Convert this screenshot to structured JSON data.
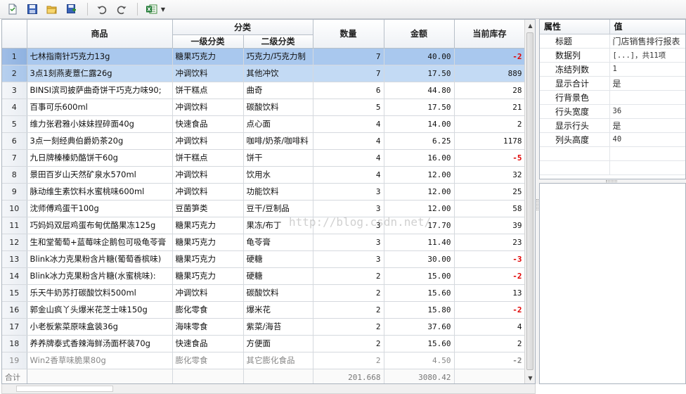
{
  "toolbar": {
    "buttons": [
      "new-icon",
      "save-icon",
      "open-folder-icon",
      "save-as-icon",
      "undo-icon",
      "redo-icon",
      "excel-export-icon"
    ]
  },
  "grid": {
    "headers": {
      "product": "商品",
      "category": "分类",
      "level1": "一级分类",
      "level2": "二级分类",
      "qty": "数量",
      "amount": "金额",
      "stock": "当前库存"
    },
    "rows": [
      {
        "n": "1",
        "name": "七林指南针巧克力13g",
        "c1": "糖果巧克力",
        "c2": "巧克力/巧克力制",
        "qty": "7",
        "amt": "40.00",
        "stock": "-2"
      },
      {
        "n": "2",
        "name": "3点1刻燕麦薏仁露26g",
        "c1": "冲调饮料",
        "c2": "其他冲饮",
        "qty": "7",
        "amt": "17.50",
        "stock": "889"
      },
      {
        "n": "3",
        "name": "BINSI滨司披萨曲奇饼干巧克力味90;",
        "c1": "饼干糕点",
        "c2": "曲奇",
        "qty": "6",
        "amt": "44.80",
        "stock": "28"
      },
      {
        "n": "4",
        "name": "百事可乐600ml",
        "c1": "冲调饮料",
        "c2": "碳酸饮料",
        "qty": "5",
        "amt": "17.50",
        "stock": "21"
      },
      {
        "n": "5",
        "name": "维力张君雅小妹妹捏碎面40g",
        "c1": "快速食品",
        "c2": "点心面",
        "qty": "4",
        "amt": "14.00",
        "stock": "2"
      },
      {
        "n": "6",
        "name": "3点一刻经典伯爵奶茶20g",
        "c1": "冲调饮料",
        "c2": "咖啡/奶茶/咖啡料",
        "qty": "4",
        "amt": "6.25",
        "stock": "1178"
      },
      {
        "n": "7",
        "name": "九日牌榛榛奶酪饼干60g",
        "c1": "饼干糕点",
        "c2": "饼干",
        "qty": "4",
        "amt": "16.00",
        "stock": "-5"
      },
      {
        "n": "8",
        "name": "景田百岁山天然矿泉水570ml",
        "c1": "冲调饮料",
        "c2": "饮用水",
        "qty": "4",
        "amt": "12.00",
        "stock": "32"
      },
      {
        "n": "9",
        "name": "脉动维生素饮料水蜜桃味600ml",
        "c1": "冲调饮料",
        "c2": "功能饮料",
        "qty": "3",
        "amt": "12.00",
        "stock": "25"
      },
      {
        "n": "10",
        "name": "沈师傅鸡蛋干100g",
        "c1": "豆菌笋类",
        "c2": "豆干/豆制品",
        "qty": "3",
        "amt": "12.00",
        "stock": "58"
      },
      {
        "n": "11",
        "name": "巧妈妈双层鸡蛋布甸优酪果冻125g",
        "c1": "糖果巧克力",
        "c2": "果冻/布丁",
        "qty": "3",
        "amt": "17.70",
        "stock": "39"
      },
      {
        "n": "12",
        "name": "生和堂葡萄+蓝莓味企鹅包可吸龟苓膏",
        "c1": "糖果巧克力",
        "c2": "龟苓膏",
        "qty": "3",
        "amt": "11.40",
        "stock": "23"
      },
      {
        "n": "13",
        "name": "Blink冰力克果粉含片糖(葡萄香槟味)",
        "c1": "糖果巧克力",
        "c2": "硬糖",
        "qty": "3",
        "amt": "30.00",
        "stock": "-3"
      },
      {
        "n": "14",
        "name": "Blink冰力克果粉含片糖(水蜜桃味):",
        "c1": "糖果巧克力",
        "c2": "硬糖",
        "qty": "2",
        "amt": "15.00",
        "stock": "-2"
      },
      {
        "n": "15",
        "name": "乐天牛奶苏打碳酸饮料500ml",
        "c1": "冲调饮料",
        "c2": "碳酸饮料",
        "qty": "2",
        "amt": "15.60",
        "stock": "13"
      },
      {
        "n": "16",
        "name": "郭金山疯丫头爆米花芝士味150g",
        "c1": "膨化零食",
        "c2": "爆米花",
        "qty": "2",
        "amt": "15.80",
        "stock": "-2"
      },
      {
        "n": "17",
        "name": "小老板紫菜原味盒装36g",
        "c1": "海味零食",
        "c2": "紫菜/海苔",
        "qty": "2",
        "amt": "37.60",
        "stock": "4"
      },
      {
        "n": "18",
        "name": "养养牌泰式香辣海鲜汤面杯装70g",
        "c1": "快速食品",
        "c2": "方便面",
        "qty": "2",
        "amt": "15.60",
        "stock": "2"
      },
      {
        "n": "19",
        "name": "Win2香草味脆果80g",
        "c1": "膨化零食",
        "c2": "其它膨化食品",
        "qty": "2",
        "amt": "4.50",
        "stock": "-2"
      }
    ],
    "totals": {
      "label": "合计",
      "qty": "201.668",
      "amt": "3080.42"
    },
    "watermark": "http://blog.csdn.net/"
  },
  "properties": {
    "header_name": "属性",
    "header_value": "值",
    "items": [
      {
        "name": "标题",
        "value": "门店销售排行报表"
      },
      {
        "name": "数据列",
        "value": "[...]，共11项"
      },
      {
        "name": "冻结列数",
        "value": "1"
      },
      {
        "name": "显示合计",
        "value": "是"
      },
      {
        "name": "行背景色",
        "value": ""
      },
      {
        "name": "行头宽度",
        "value": "36"
      },
      {
        "name": "显示行头",
        "value": "是"
      },
      {
        "name": "列头高度",
        "value": "40"
      }
    ]
  },
  "colors": {
    "selected_row": "#a9c8ee",
    "selected_row2": "#c3daf4",
    "negative": "#e00000",
    "header_bg": "#eef1f5"
  }
}
